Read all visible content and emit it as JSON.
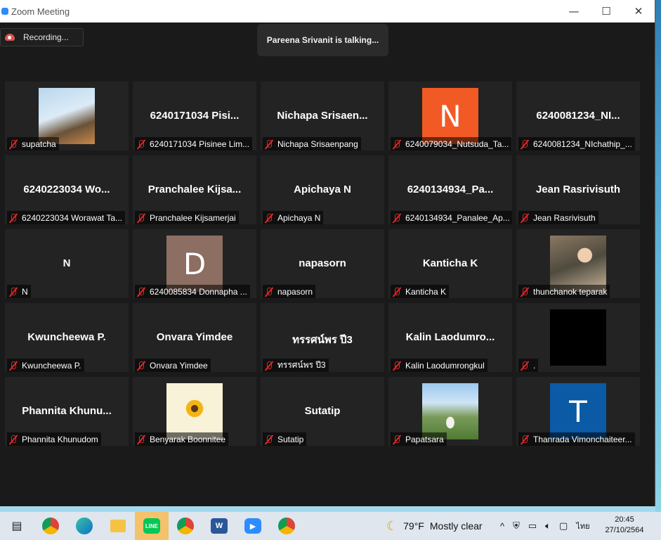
{
  "window": {
    "title": "Zoom Meeting",
    "controls": {
      "minimize": "—",
      "maximize": "☐",
      "close": "✕"
    }
  },
  "recording_label": "Recording...",
  "talking_banner": "Pareena Srivanit is talking...",
  "tiles": [
    {
      "big": "",
      "label": "supatcha",
      "avatar": "photo-sky"
    },
    {
      "big": "6240171034 Pisi...",
      "label": "6240171034 Pisinee Lim..."
    },
    {
      "big": "Nichapa  Srisaen...",
      "label": "Nichapa Srisaenpang"
    },
    {
      "big": "",
      "label": "6240079034_Nutsuda_Ta...",
      "avatar": "letter",
      "letter": "N",
      "color": "#f15a24"
    },
    {
      "big": "6240081234_NI...",
      "label": "6240081234_NIchathip_..."
    },
    {
      "big": "6240223034 Wo...",
      "label": "6240223034 Worawat Ta..."
    },
    {
      "big": "Pranchalee  Kijsa...",
      "label": "Pranchalee Kijsamerjai"
    },
    {
      "big": "Apichaya N",
      "label": "Apichaya N"
    },
    {
      "big": "6240134934_Pa...",
      "label": "6240134934_Panalee_Ap..."
    },
    {
      "big": "Jean Rasrivisuth",
      "label": "Jean Rasrivisuth"
    },
    {
      "big": "N",
      "label": "N"
    },
    {
      "big": "",
      "label": "6240085834 Donnapha ...",
      "avatar": "letter",
      "letter": "D",
      "color": "#8d6e63"
    },
    {
      "big": "napasorn",
      "label": "napasorn"
    },
    {
      "big": "Kanticha K",
      "label": "Kanticha K"
    },
    {
      "big": "",
      "label": "thunchanok teparak",
      "avatar": "photo-person"
    },
    {
      "big": "Kwuncheewa P.",
      "label": "Kwuncheewa P."
    },
    {
      "big": "Onvara Yimdee",
      "label": "Onvara Yimdee"
    },
    {
      "big": "ทรรศน์พร ปี3",
      "label": "ทรรศน์พร ปี3"
    },
    {
      "big": "Kalin  Laodumro...",
      "label": "Kalin Laodumrongkul"
    },
    {
      "big": "",
      "label": ".",
      "avatar": "black"
    },
    {
      "big": "Phannita  Khunu...",
      "label": "Phannita Khunudom"
    },
    {
      "big": "",
      "label": "Benyarak Boonnitee",
      "avatar": "photo-sunflower"
    },
    {
      "big": "Sutatip",
      "label": "Sutatip"
    },
    {
      "big": "",
      "label": "Papatsara",
      "avatar": "photo-outdoor"
    },
    {
      "big": "",
      "label": "Thanrada Vimonchaiteer...",
      "avatar": "letter",
      "letter": "T",
      "color": "#0b5aa5"
    }
  ],
  "taskbar": {
    "icons": [
      "task-view-icon",
      "chrome-icon",
      "edge-icon",
      "file-explorer-icon",
      "line-icon",
      "chrome-profile-a-icon",
      "word-icon",
      "zoom-icon",
      "chrome-profile-l-icon"
    ],
    "weather_temp": "79°F",
    "weather_desc": "Mostly clear",
    "language": "ไทย",
    "time": "20:45",
    "date": "27/10/2564"
  }
}
